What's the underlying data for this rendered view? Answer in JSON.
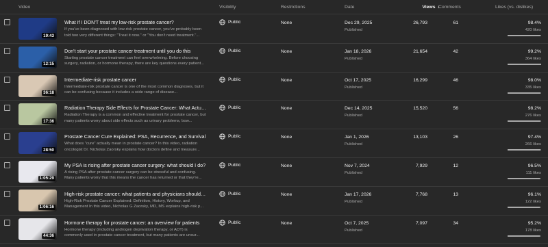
{
  "header": {
    "video": "Video",
    "visibility": "Visibility",
    "restrictions": "Restrictions",
    "date": "Date",
    "views": "Views",
    "comments": "Comments",
    "likes": "Likes (vs. dislikes)",
    "sort_icon": "arrow-down-icon"
  },
  "rows": [
    {
      "duration": "19:43",
      "title": "What if I DON'T treat my low-risk prostate cancer?",
      "description": "If you've been diagnosed with low-risk prostate cancer, you've probably been told two very different things: \"Treat it now.\" or \"You don't need treatment.\"...",
      "visibility": "Public",
      "restrictions": "None",
      "date": "Dec 29, 2025",
      "status": "Published",
      "views": "26,793",
      "comments": "61",
      "likes_pct": "98.4%",
      "likes_count": "420 likes",
      "like_fraction": 0.984,
      "thumb_color": "#1f3b86"
    },
    {
      "duration": "12:15",
      "title": "Don't start your prostate cancer treatment until you do this",
      "description": "Starting prostate cancer treatment can feel overwhelming. Before choosing surgery, radiation, or hormone therapy, there are key questions every patient...",
      "visibility": "Public",
      "restrictions": "None",
      "date": "Jan 18, 2026",
      "status": "Published",
      "views": "21,654",
      "comments": "42",
      "likes_pct": "99.2%",
      "likes_count": "364 likes",
      "like_fraction": 0.992,
      "thumb_color": "#2b5fa8"
    },
    {
      "duration": "36:18",
      "title": "Intermediate-risk prostate cancer",
      "description": "Intermediate-risk prostate cancer is one of the most common diagnoses, but it can be confusing because it includes a wide range of disease...",
      "visibility": "Public",
      "restrictions": "None",
      "date": "Oct 17, 2025",
      "status": "Published",
      "views": "16,299",
      "comments": "46",
      "likes_pct": "98.0%",
      "likes_count": "335 likes",
      "like_fraction": 0.98,
      "thumb_color": "#d9c8b4"
    },
    {
      "duration": "17:36",
      "title": "Radiation Therapy Side Effects for Prostate Cancer: What Actually Hap...",
      "description": "Radiation Therapy is a common and effective treatment for prostate cancer, but many patients worry about side effects such as urinary problems, bow...",
      "visibility": "Public",
      "restrictions": "None",
      "date": "Dec 14, 2025",
      "status": "Published",
      "views": "15,520",
      "comments": "56",
      "likes_pct": "98.2%",
      "likes_count": "276 likes",
      "like_fraction": 0.982,
      "thumb_color": "#b9c7a0"
    },
    {
      "duration": "28:50",
      "title": "Prostate Cancer Cure Explained: PSA, Recurrence, and Survival",
      "description": "What does \"cure\" actually mean in prostate cancer? In this video, radiation oncologist Dr. Nicholas Zaorsky explains how doctors define and measure...",
      "visibility": "Public",
      "restrictions": "None",
      "date": "Jan 1, 2026",
      "status": "Published",
      "views": "13,103",
      "comments": "26",
      "likes_pct": "97.4%",
      "likes_count": "266 likes",
      "like_fraction": 0.974,
      "thumb_color": "#2a3f8f"
    },
    {
      "duration": "1:05:29",
      "title": "My PSA is rising after prostate cancer surgery: what should I do?",
      "description": "A rising PSA after prostate cancer surgery can be stressful and confusing. Many patients worry that this means the cancer has returned or that they're...",
      "visibility": "Public",
      "restrictions": "None",
      "date": "Nov 7, 2024",
      "status": "Published",
      "views": "7,929",
      "comments": "12",
      "likes_pct": "96.5%",
      "likes_count": "111 likes",
      "like_fraction": 0.965,
      "thumb_color": "#e8e8ee"
    },
    {
      "duration": "1:06:16",
      "title": "High-risk prostate cancer: what patients and physicians should know i...",
      "description": "High-Risk Prostate Cancer Explained: Definition, History, Workup, and Management In this video, Nicholas G Zaorsky, MD, MS explains high-risk p...",
      "visibility": "Public",
      "restrictions": "None",
      "date": "Jan 17, 2026",
      "status": "Published",
      "views": "7,768",
      "comments": "13",
      "likes_pct": "96.1%",
      "likes_count": "122 likes",
      "like_fraction": 0.961,
      "thumb_color": "#d8c6ae"
    },
    {
      "duration": "44:36",
      "title": "Hormone therapy for prostate cancer: an overview for patients",
      "description": "Hormone therapy (including androgen deprivation therapy, or ADT) is commonly used in prostate cancer treatment, but many patients are unsur...",
      "visibility": "Public",
      "restrictions": "None",
      "date": "Oct 7, 2025",
      "status": "Published",
      "views": "7,097",
      "comments": "34",
      "likes_pct": "95.2%",
      "likes_count": "178 likes",
      "like_fraction": 0.952,
      "thumb_color": "#e6e6ea"
    }
  ]
}
